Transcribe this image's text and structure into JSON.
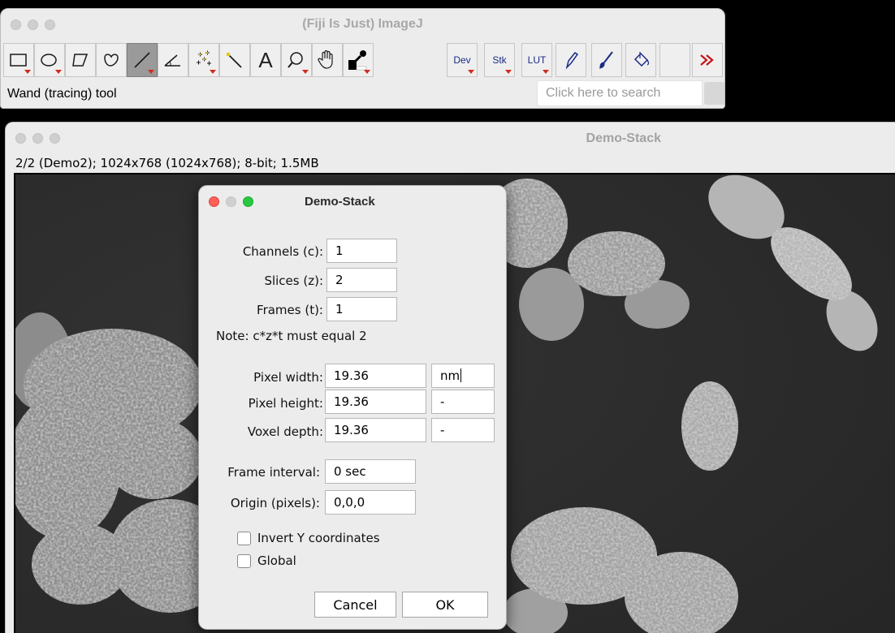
{
  "imagej": {
    "title": "(Fiji Is Just) ImageJ",
    "status": "Wand (tracing) tool",
    "search_placeholder": "Click here to search",
    "tools": [
      {
        "name": "rectangle-tool",
        "icon": "rectangle-icon"
      },
      {
        "name": "oval-tool",
        "icon": "oval-icon"
      },
      {
        "name": "polygon-tool",
        "icon": "polygon-icon"
      },
      {
        "name": "freehand-tool",
        "icon": "freehand-icon"
      },
      {
        "name": "line-tool",
        "icon": "line-icon",
        "active": true
      },
      {
        "name": "angle-tool",
        "icon": "angle-icon"
      },
      {
        "name": "point-tool",
        "icon": "point-icon"
      },
      {
        "name": "wand-tool",
        "icon": "wand-icon"
      },
      {
        "name": "text-tool",
        "icon": "text-icon",
        "label": "A"
      },
      {
        "name": "zoom-tool",
        "icon": "magnifier-icon"
      },
      {
        "name": "hand-tool",
        "icon": "hand-icon"
      },
      {
        "name": "color-picker-tool",
        "icon": "dropper-icon"
      },
      {
        "name": "dev-menu",
        "icon": "",
        "label": "Dev"
      },
      {
        "name": "stk-menu",
        "icon": "",
        "label": "Stk"
      },
      {
        "name": "lut-menu",
        "icon": "",
        "label": "LUT"
      },
      {
        "name": "pencil-tool",
        "icon": "pencil-icon"
      },
      {
        "name": "brush-tool",
        "icon": "brush-icon"
      },
      {
        "name": "flood-fill-tool",
        "icon": "bucket-icon"
      },
      {
        "name": "empty-slot",
        "icon": ""
      },
      {
        "name": "more-tools",
        "icon": "double-chevron-icon"
      }
    ],
    "colors": {
      "accent_triangle": "#d22b1f",
      "text_tool_label": "#1b2a86"
    }
  },
  "stack_window": {
    "title": "Demo-Stack",
    "info": "2/2 (Demo2); 1024x768  (1024x768); 8-bit; 1.5MB"
  },
  "dialog": {
    "title": "Demo-Stack",
    "channels_label": "Channels (c):",
    "channels_value": "1",
    "slices_label": "Slices (z):",
    "slices_value": "2",
    "frames_label": "Frames (t):",
    "frames_value": "1",
    "note": "Note: c*z*t must equal 2",
    "pixel_width_label": "Pixel width:",
    "pixel_width_value": "19.36",
    "unit_value": "nm",
    "pixel_height_label": "Pixel height:",
    "pixel_height_value": "19.36",
    "pixel_height_unit": "-",
    "voxel_depth_label": "Voxel depth:",
    "voxel_depth_value": "19.36",
    "voxel_depth_unit": "-",
    "frame_interval_label": "Frame interval:",
    "frame_interval_value": "0 sec",
    "origin_label": "Origin (pixels):",
    "origin_value": "0,0,0",
    "invert_y_label": "Invert Y coordinates",
    "global_label": "Global",
    "cancel_label": "Cancel",
    "ok_label": "OK"
  }
}
